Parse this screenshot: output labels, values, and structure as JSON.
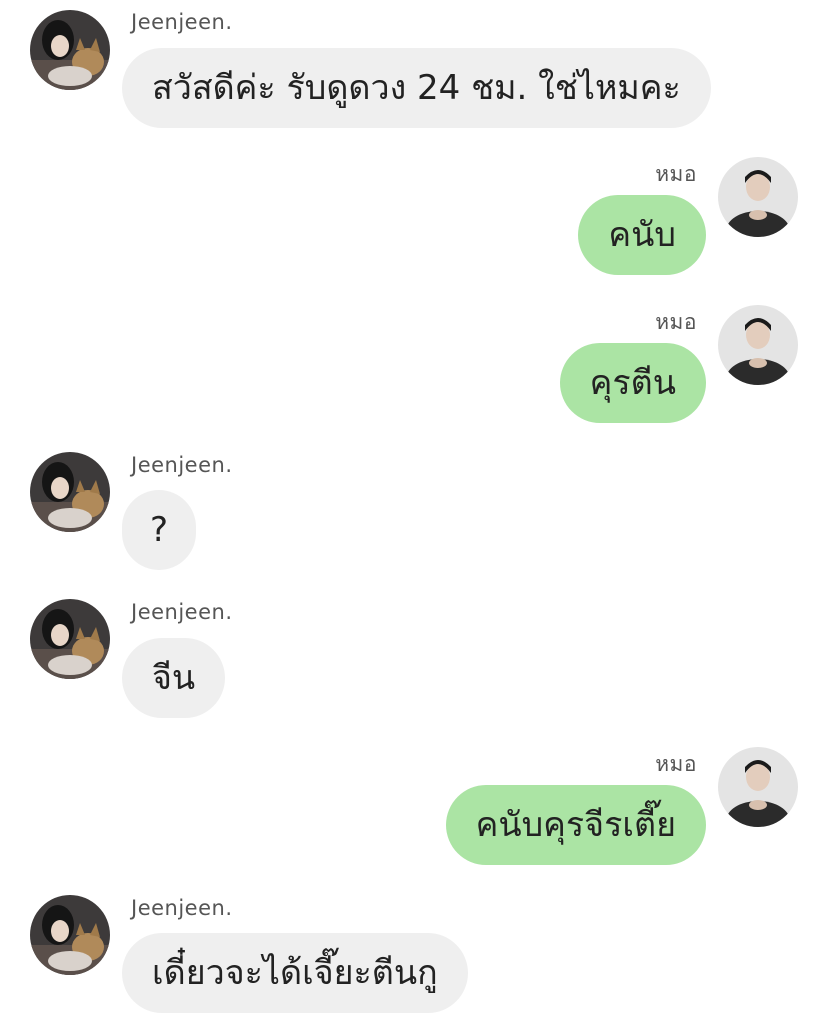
{
  "messages": [
    {
      "sender": "Jeenjeen.",
      "side": "in",
      "text": "สวัสดีค่ะ รับดูดวง 24 ชม. ใช่ไหมคะ"
    },
    {
      "sender": "หมอ",
      "side": "out",
      "text": "คนับ"
    },
    {
      "sender": "หมอ",
      "side": "out",
      "text": "คุรตีน"
    },
    {
      "sender": "Jeenjeen.",
      "side": "in",
      "text": "?"
    },
    {
      "sender": "Jeenjeen.",
      "side": "in",
      "text": "จีน"
    },
    {
      "sender": "หมอ",
      "side": "out",
      "text": "คนับคุรจีรเตี๊ย"
    },
    {
      "sender": "Jeenjeen.",
      "side": "in",
      "text": "เดี๋ยวจะได้เจี๊ยะตีนกู"
    }
  ],
  "colors": {
    "incoming_bubble": "#efefef",
    "outgoing_bubble": "#abe4a4",
    "sender_name": "#555555",
    "message_text": "#222222"
  },
  "icons": {
    "incoming_avatar": "user-with-cat-avatar-icon",
    "outgoing_avatar": "user-portrait-avatar-icon"
  }
}
